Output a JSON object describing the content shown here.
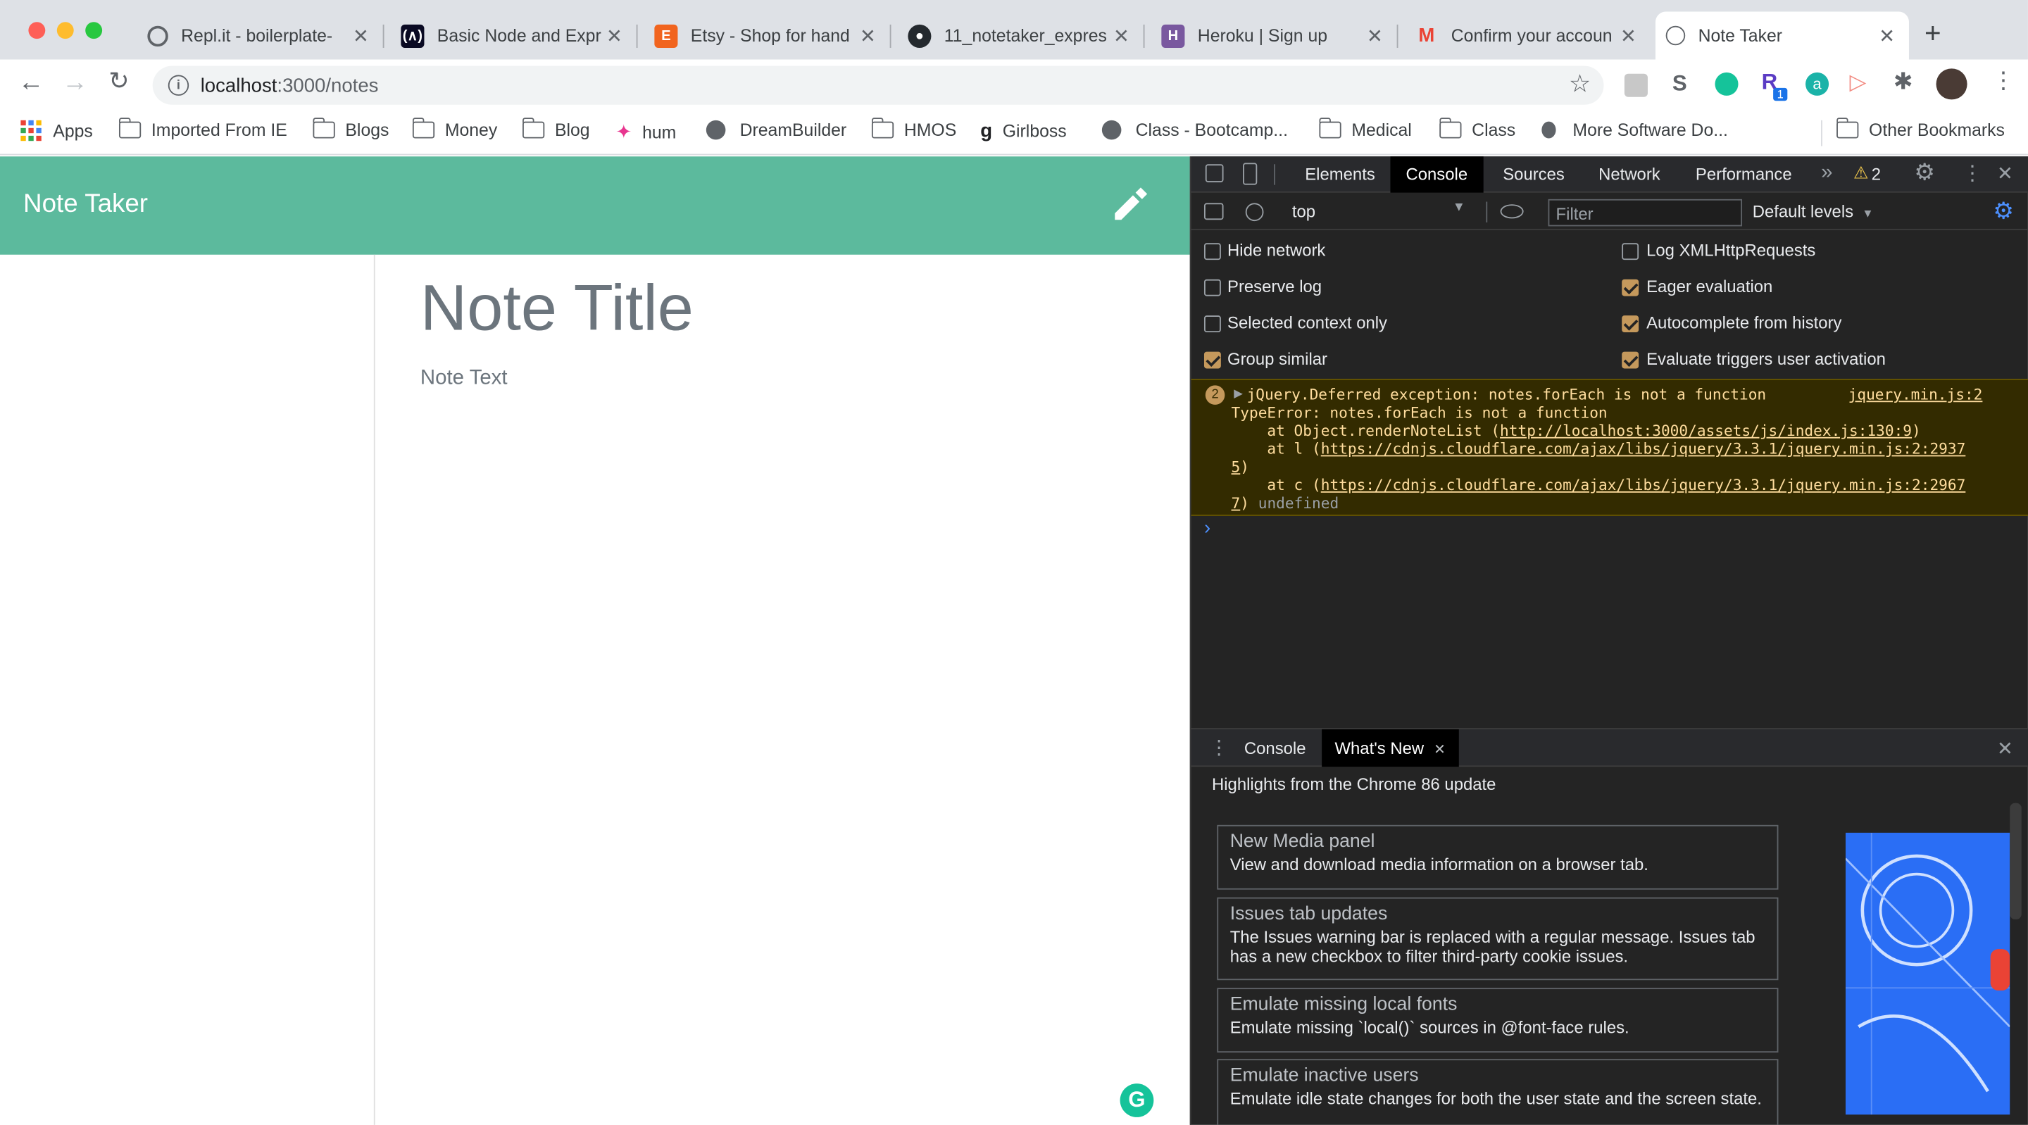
{
  "browser": {
    "tabs": [
      {
        "title": "Repl.it - boilerplate-",
        "favicon": "replit-icon"
      },
      {
        "title": "Basic Node and Expr",
        "favicon": "freecodecamp-icon"
      },
      {
        "title": "Etsy - Shop for hand",
        "favicon": "etsy-icon"
      },
      {
        "title": "11_notetaker_expres",
        "favicon": "github-icon"
      },
      {
        "title": "Heroku | Sign up",
        "favicon": "heroku-icon"
      },
      {
        "title": "Confirm your accoun",
        "favicon": "gmail-icon"
      },
      {
        "title": "Note Taker",
        "favicon": "globe-icon"
      }
    ],
    "url_host": "localhost",
    "url_path": ":3000/notes",
    "bookmarks": [
      {
        "label": "Apps",
        "icon": "apps-grid-icon"
      },
      {
        "label": "Imported From IE",
        "icon": "folder-icon"
      },
      {
        "label": "Blogs",
        "icon": "folder-icon"
      },
      {
        "label": "Money",
        "icon": "folder-icon"
      },
      {
        "label": "Blog",
        "icon": "folder-icon"
      },
      {
        "label": "hum",
        "icon": "hum-icon"
      },
      {
        "label": "DreamBuilder",
        "icon": "globe-icon"
      },
      {
        "label": "HMOS",
        "icon": "folder-icon"
      },
      {
        "label": "Girlboss",
        "icon": "girlboss-icon"
      },
      {
        "label": "Class - Bootcamp...",
        "icon": "globe-icon"
      },
      {
        "label": "Medical",
        "icon": "folder-icon"
      },
      {
        "label": "Class",
        "icon": "folder-icon"
      },
      {
        "label": "More Software Do...",
        "icon": "apple-icon"
      }
    ],
    "other_bookmarks": "Other Bookmarks",
    "extension_badge": "1"
  },
  "app": {
    "brand": "Note Taker",
    "note_title_placeholder": "Note Title",
    "note_text_placeholder": "Note Text",
    "colors": {
      "navbar": "#5cba9d"
    }
  },
  "devtools": {
    "tabs": [
      "Elements",
      "Console",
      "Sources",
      "Network",
      "Performance"
    ],
    "active_tab": "Console",
    "warning_count": "2",
    "context": "top",
    "filter_placeholder": "Filter",
    "levels": "Default levels",
    "options_left": [
      {
        "label": "Hide network",
        "checked": false
      },
      {
        "label": "Preserve log",
        "checked": false
      },
      {
        "label": "Selected context only",
        "checked": false
      },
      {
        "label": "Group similar",
        "checked": true
      }
    ],
    "options_right": [
      {
        "label": "Log XMLHttpRequests",
        "checked": false
      },
      {
        "label": "Eager evaluation",
        "checked": true
      },
      {
        "label": "Autocomplete from history",
        "checked": true
      },
      {
        "label": "Evaluate triggers user activation",
        "checked": true
      }
    ],
    "message": {
      "count": "2",
      "line1": "jQuery.Deferred exception: notes.forEach is not a function",
      "source": "jquery.min.js:2",
      "line2": "TypeError: notes.forEach is not a function",
      "line3_prefix": "    at Object.renderNoteList (",
      "line3_link": "http://localhost:3000/assets/js/index.js:130:9",
      "line3_suffix": ")",
      "line4_prefix": "    at l (",
      "line4_link": "https://cdnjs.cloudflare.com/ajax/libs/jquery/3.3.1/jquery.min.js:2:2937",
      "line5_link": "5",
      "line5_suffix": ")",
      "line6_prefix": "    at c (",
      "line6_link": "https://cdnjs.cloudflare.com/ajax/libs/jquery/3.3.1/jquery.min.js:2:2967",
      "line7_link": "7",
      "line7_suffix": ") ",
      "undefined": "undefined"
    },
    "prompt": "›",
    "drawer": {
      "tabs": [
        "Console",
        "What's New"
      ],
      "active": "What's New",
      "heading": "Highlights from the Chrome 86 update",
      "items": [
        {
          "title": "New Media panel",
          "desc": "View and download media information on a browser tab."
        },
        {
          "title": "Issues tab updates",
          "desc": "The Issues warning bar is replaced with a regular message. Issues tab has a new checkbox to filter third-party cookie issues."
        },
        {
          "title": "Emulate missing local fonts",
          "desc": "Emulate missing `local()` sources in @font-face rules."
        },
        {
          "title": "Emulate inactive users",
          "desc": "Emulate idle state changes for both the user state and the screen state."
        }
      ]
    }
  }
}
